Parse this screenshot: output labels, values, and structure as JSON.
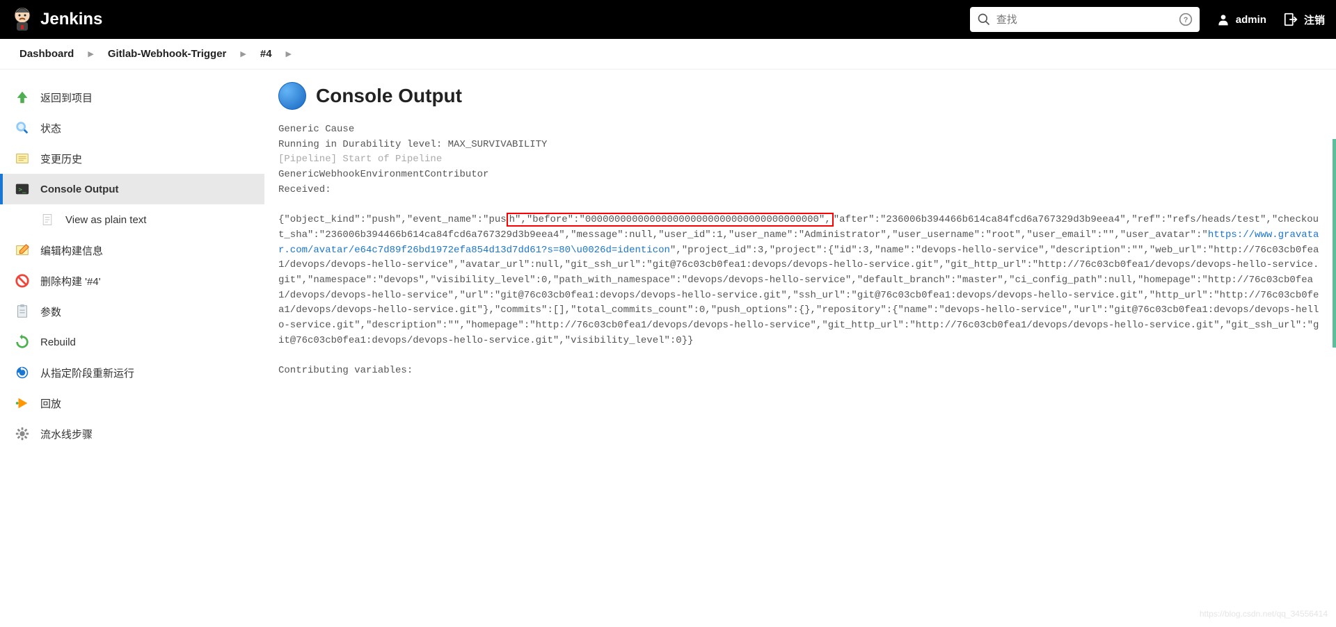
{
  "header": {
    "brand": "Jenkins",
    "search_placeholder": "查找",
    "user": "admin",
    "logout": "注销"
  },
  "breadcrumb": {
    "items": [
      "Dashboard",
      "Gitlab-Webhook-Trigger",
      "#4"
    ]
  },
  "sidebar": {
    "items": [
      {
        "label": "返回到项目",
        "icon": "up-arrow"
      },
      {
        "label": "状态",
        "icon": "magnifier"
      },
      {
        "label": "变更历史",
        "icon": "notepad"
      },
      {
        "label": "Console Output",
        "icon": "terminal",
        "active": true
      },
      {
        "label": "View as plain text",
        "icon": "doc",
        "indent": true
      },
      {
        "label": "编辑构建信息",
        "icon": "notepad2"
      },
      {
        "label": "删除构建 '#4'",
        "icon": "forbidden"
      },
      {
        "label": "参数",
        "icon": "clipboard"
      },
      {
        "label": "Rebuild",
        "icon": "refresh-green"
      },
      {
        "label": "从指定阶段重新运行",
        "icon": "refresh-blue"
      },
      {
        "label": "回放",
        "icon": "play-orange"
      },
      {
        "label": "流水线步骤",
        "icon": "gear"
      }
    ]
  },
  "main": {
    "title": "Console Output",
    "lines": {
      "l0": "Generic Cause",
      "l1": "Running in Durability level: MAX_SURVIVABILITY",
      "l2": "[Pipeline] Start of Pipeline",
      "l3": "GenericWebhookEnvironmentContributor",
      "l4": " Received:",
      "json_pre": "{\"object_kind\":\"push\",\"event_name\":\"pus",
      "json_highlight": "h\",\"before\":\"0000000000000000000000000000000000000000\",",
      "json_mid1": "\"after\":\"236006b394466b614ca84fcd6a767329d3b9eea4\",\"ref\":\"refs/heads/test\",\"checkout_sha\":\"236006b394466b614ca84fcd6a767329d3b9eea4\",\"message\":null,\"user_id\":1,\"user_name\":\"Administrator\",\"user_username\":\"root\",\"user_email\":\"\",\"user_avatar\":\"",
      "json_link": "https://www.gravatar.com/avatar/e64c7d89f26bd1972efa854d13d7dd61?s=80\\u0026d=identicon",
      "json_mid2": "\",\"project_id\":3,\"project\":{\"id\":3,\"name\":\"devops-hello-service\",\"description\":\"\",\"web_url\":\"http://76c03cb0fea1/devops/devops-hello-service\",\"avatar_url\":null,\"git_ssh_url\":\"git@76c03cb0fea1:devops/devops-hello-service.git\",\"git_http_url\":\"http://76c03cb0fea1/devops/devops-hello-service.git\",\"namespace\":\"devops\",\"visibility_level\":0,\"path_with_namespace\":\"devops/devops-hello-service\",\"default_branch\":\"master\",\"ci_config_path\":null,\"homepage\":\"http://76c03cb0fea1/devops/devops-hello-service\",\"url\":\"git@76c03cb0fea1:devops/devops-hello-service.git\",\"ssh_url\":\"git@76c03cb0fea1:devops/devops-hello-service.git\",\"http_url\":\"http://76c03cb0fea1/devops/devops-hello-service.git\"},\"commits\":[],\"total_commits_count\":0,\"push_options\":{},\"repository\":{\"name\":\"devops-hello-service\",\"url\":\"git@76c03cb0fea1:devops/devops-hello-service.git\",\"description\":\"\",\"homepage\":\"http://76c03cb0fea1/devops/devops-hello-service\",\"git_http_url\":\"http://76c03cb0fea1/devops/devops-hello-service.git\",\"git_ssh_url\":\"git@76c03cb0fea1:devops/devops-hello-service.git\",\"visibility_level\":0}}",
      "contrib": "Contributing variables:"
    }
  },
  "watermark": "https://blog.csdn.net/qq_34556414"
}
